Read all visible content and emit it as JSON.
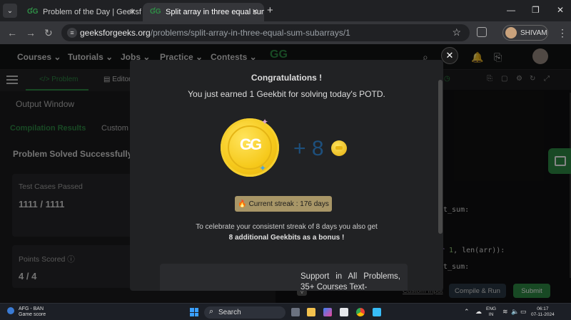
{
  "browser": {
    "tabs": [
      {
        "title": "Problem of the Day | GeeksforG",
        "active": false
      },
      {
        "title": "Split array in three equal sum su",
        "active": true
      }
    ],
    "url_domain": "geeksforgeeks.org",
    "url_path": "/problems/split-array-in-three-equal-sum-subarrays/1",
    "profile_name": "SHIVAM"
  },
  "site_nav": {
    "items": [
      "Courses",
      "Tutorials",
      "Jobs",
      "Practice",
      "Contests"
    ],
    "logo": "GG"
  },
  "left_panel": {
    "tabs": [
      "Problem",
      "Editorial"
    ],
    "output_window": "Output Window",
    "result_tabs": [
      "Compilation Results",
      "Custom"
    ],
    "solved_text": "Problem Solved Successfully",
    "test_cases_label": "Test Cases Passed",
    "test_cases_value": "1111 / 1111",
    "points_label": "Points Scored",
    "points_value": "4 / 4"
  },
  "editor": {
    "code_lines": [
      {
        "pre": "",
        "text": "t_sum:"
      },
      {
        "pre": "r ",
        "num": "1",
        "rest": ", len(arr)):"
      },
      {
        "pre": "",
        "text": "t_sum:"
      }
    ],
    "custom_input": "Custom Input",
    "compile_run": "Compile & Run",
    "submit": "Submit",
    "v_badge": "V"
  },
  "modal": {
    "title": "Congratulations !",
    "subtitle": "You just earned 1 Geekbit for solving today's POTD.",
    "bonus": "+ 8",
    "streak": "Current streak : 176 days",
    "celebrate_line1": "To celebrate your consistent streak of 8 days you also get",
    "celebrate_line2": "8 additional Geekbits as a bonus !",
    "promo": "Support in All Problems, 35+ Courses Text-",
    "coin_logo": "GG"
  },
  "taskbar": {
    "weather_line1": "AFG - BAN",
    "weather_line2": "Game score",
    "search": "Search",
    "lang_line1": "ENG",
    "lang_line2": "IN",
    "time": "06:17",
    "date": "07-11-2024"
  },
  "colors": {
    "accent_green": "#2f8d46",
    "streak_bg": "#a89667",
    "coin_gold": "#f6c91b"
  }
}
